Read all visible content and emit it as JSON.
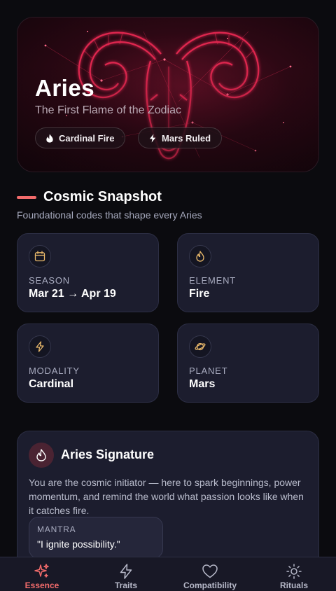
{
  "hero": {
    "title": "Aries",
    "subtitle": "The First Flame of the Zodiac",
    "chips": [
      {
        "icon": "flame-icon",
        "label": "Cardinal Fire"
      },
      {
        "icon": "bolt-icon",
        "label": "Mars Ruled"
      }
    ]
  },
  "snapshot": {
    "title": "Cosmic Snapshot",
    "subtitle": "Foundational codes that shape every Aries",
    "cards": [
      {
        "icon": "calendar-icon",
        "label": "SEASON",
        "value": "Mar 21 → Apr 19"
      },
      {
        "icon": "flame-icon",
        "label": "ELEMENT",
        "value": "Fire"
      },
      {
        "icon": "bolt-icon",
        "label": "MODALITY",
        "value": "Cardinal"
      },
      {
        "icon": "planet-icon",
        "label": "PLANET",
        "value": "Mars"
      }
    ]
  },
  "signature": {
    "title": "Aries Signature",
    "body": "You are the cosmic initiator — here to spark beginnings, power momentum, and remind the world what passion looks like when it catches fire.",
    "mantra_label": "MANTRA",
    "mantra": "\"I ignite possibility.\""
  },
  "nav": {
    "items": [
      {
        "icon": "sparkles-icon",
        "label": "Essence",
        "active": true
      },
      {
        "icon": "bolt-icon",
        "label": "Traits",
        "active": false
      },
      {
        "icon": "heart-icon",
        "label": "Compatibility",
        "active": false
      },
      {
        "icon": "sun-icon",
        "label": "Rituals",
        "active": false
      }
    ]
  },
  "colors": {
    "background": "#0b0b0f",
    "card": "#1c1d2e",
    "accent": "#f26b6b",
    "hero_red": "#e0284f",
    "icon_gold": "#e8b86a"
  }
}
